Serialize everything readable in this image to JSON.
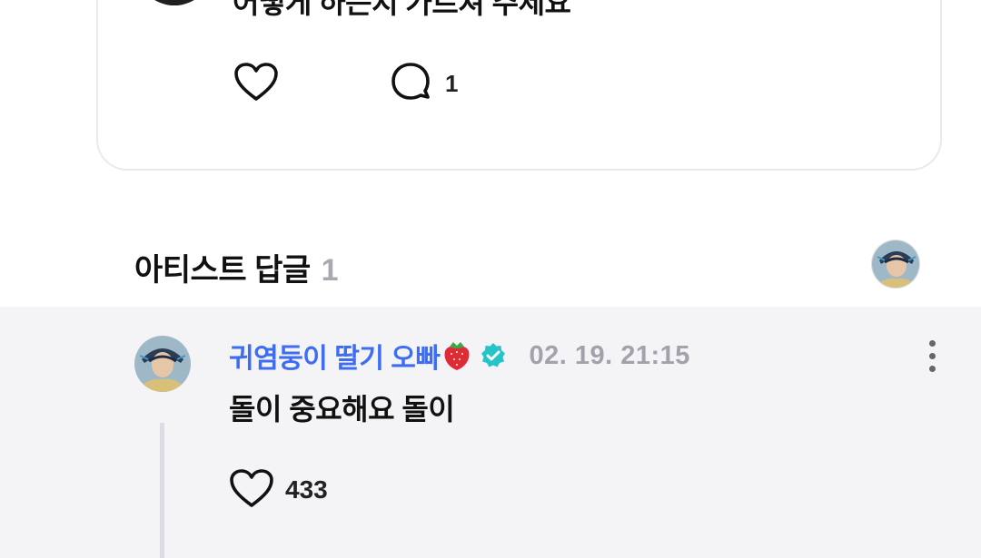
{
  "post": {
    "text": "어떻게 하는지 가르쳐 주세요",
    "like_icon": "heart-outline-icon",
    "comment_icon": "speech-bubble-icon",
    "comment_count": "1"
  },
  "artist_replies": {
    "title": "아티스트 답글",
    "count": "1"
  },
  "reply": {
    "author": "귀염둥이 딸기 오빠",
    "author_emoji": "strawberry-icon",
    "verified_icon": "verified-badge-icon",
    "timestamp": "02. 19. 21:15",
    "text": "돌이 중요해요 돌이",
    "like_count": "433"
  },
  "colors": {
    "author_blue": "#3e6df2",
    "verified_teal": "#25c4c9",
    "muted_gray": "#a2a2aa",
    "reply_background": "#f4f4f7"
  }
}
